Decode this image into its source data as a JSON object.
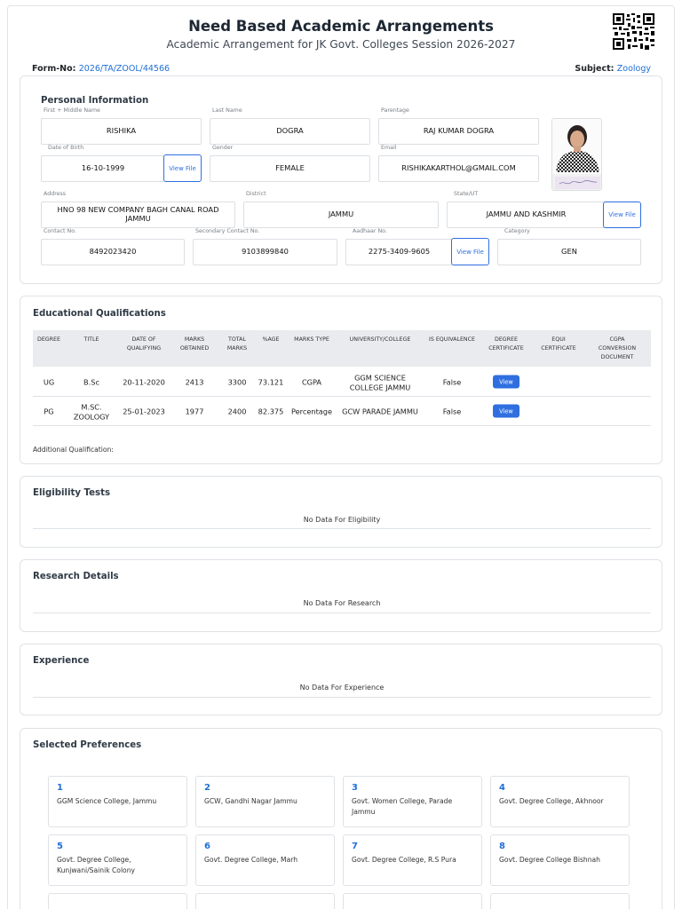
{
  "header": {
    "title": "Need Based Academic Arrangements",
    "subtitle": "Academic Arrangement for JK Govt. Colleges Session 2026-2027",
    "form_no_label": "Form-No:",
    "form_no": "2026/TA/ZOOL/44566",
    "subject_label": "Subject:",
    "subject": "Zoology"
  },
  "personal": {
    "title": "Personal Information",
    "first_name_label": "First + Middle Name",
    "first_name": "RISHIKA",
    "last_name_label": "Last Name",
    "last_name": "DOGRA",
    "parentage_label": "Parentage",
    "parentage": "RAJ KUMAR DOGRA",
    "dob_label": "Date of Birth",
    "dob": "16-10-1999",
    "gender_label": "Gender",
    "gender": "FEMALE",
    "email_label": "Email",
    "email": "RISHIKAKARTHOL@GMAIL.COM",
    "address_label": "Address",
    "address": "HNO 98 NEW COMPANY BAGH CANAL ROAD JAMMU",
    "district_label": "District",
    "district": "JAMMU",
    "state_label": "State/UT",
    "state": "JAMMU AND KASHMIR",
    "contact_label": "Contact No.",
    "contact": "8492023420",
    "secondary_label": "Secondary Contact No.",
    "secondary": "9103899840",
    "aadhaar_label": "Aadhaar No.",
    "aadhaar": "2275-3409-9605",
    "category_label": "Category",
    "category": "GEN",
    "view_file": "View File"
  },
  "education": {
    "title": "Educational Qualifications",
    "headers": [
      "DEGREE",
      "TITLE",
      "DATE OF QUALIFYING",
      "MARKS OBTAINED",
      "TOTAL MARKS",
      "%AGE",
      "MARKS TYPE",
      "UNIVERSITY/COLLEGE",
      "IS EQUIVALENCE",
      "DEGREE CERTIFICATE",
      "EQUI CERTIFICATE",
      "CGPA CONVERSION DOCUMENT"
    ],
    "rows": [
      {
        "degree": "UG",
        "title": "B.Sc",
        "date": "20-11-2020",
        "obtained": "2413",
        "total": "3300",
        "pct": "73.121",
        "type": "CGPA",
        "university": "GGM SCIENCE COLLEGE JAMMU",
        "equivalence": "False",
        "certificate": "View"
      },
      {
        "degree": "PG",
        "title": "M.SC. ZOOLOGY",
        "date": "25-01-2023",
        "obtained": "1977",
        "total": "2400",
        "pct": "82.375",
        "type": "Percentage",
        "university": "GCW PARADE JAMMU",
        "equivalence": "False",
        "certificate": "View"
      }
    ],
    "additional": "Additional Qualification:"
  },
  "eligibility": {
    "title": "Eligibility Tests",
    "empty": "No Data For Eligibility"
  },
  "research": {
    "title": "Research Details",
    "empty": "No Data For Research"
  },
  "experience": {
    "title": "Experience",
    "empty": "No Data For Experience"
  },
  "preferences": {
    "title": "Selected Preferences",
    "items": [
      {
        "num": "1",
        "name": "GGM Science College, Jammu"
      },
      {
        "num": "2",
        "name": "GCW, Gandhi Nagar Jammu"
      },
      {
        "num": "3",
        "name": "Govt. Women College, Parade Jammu"
      },
      {
        "num": "4",
        "name": "Govt. Degree College, Akhnoor"
      },
      {
        "num": "5",
        "name": "Govt. Degree College, Kunjwani/Sainik Colony"
      },
      {
        "num": "6",
        "name": "Govt. Degree College, Marh"
      },
      {
        "num": "7",
        "name": "Govt. Degree College, R.S Pura"
      },
      {
        "num": "8",
        "name": "Govt. Degree College Bishnah"
      }
    ]
  }
}
